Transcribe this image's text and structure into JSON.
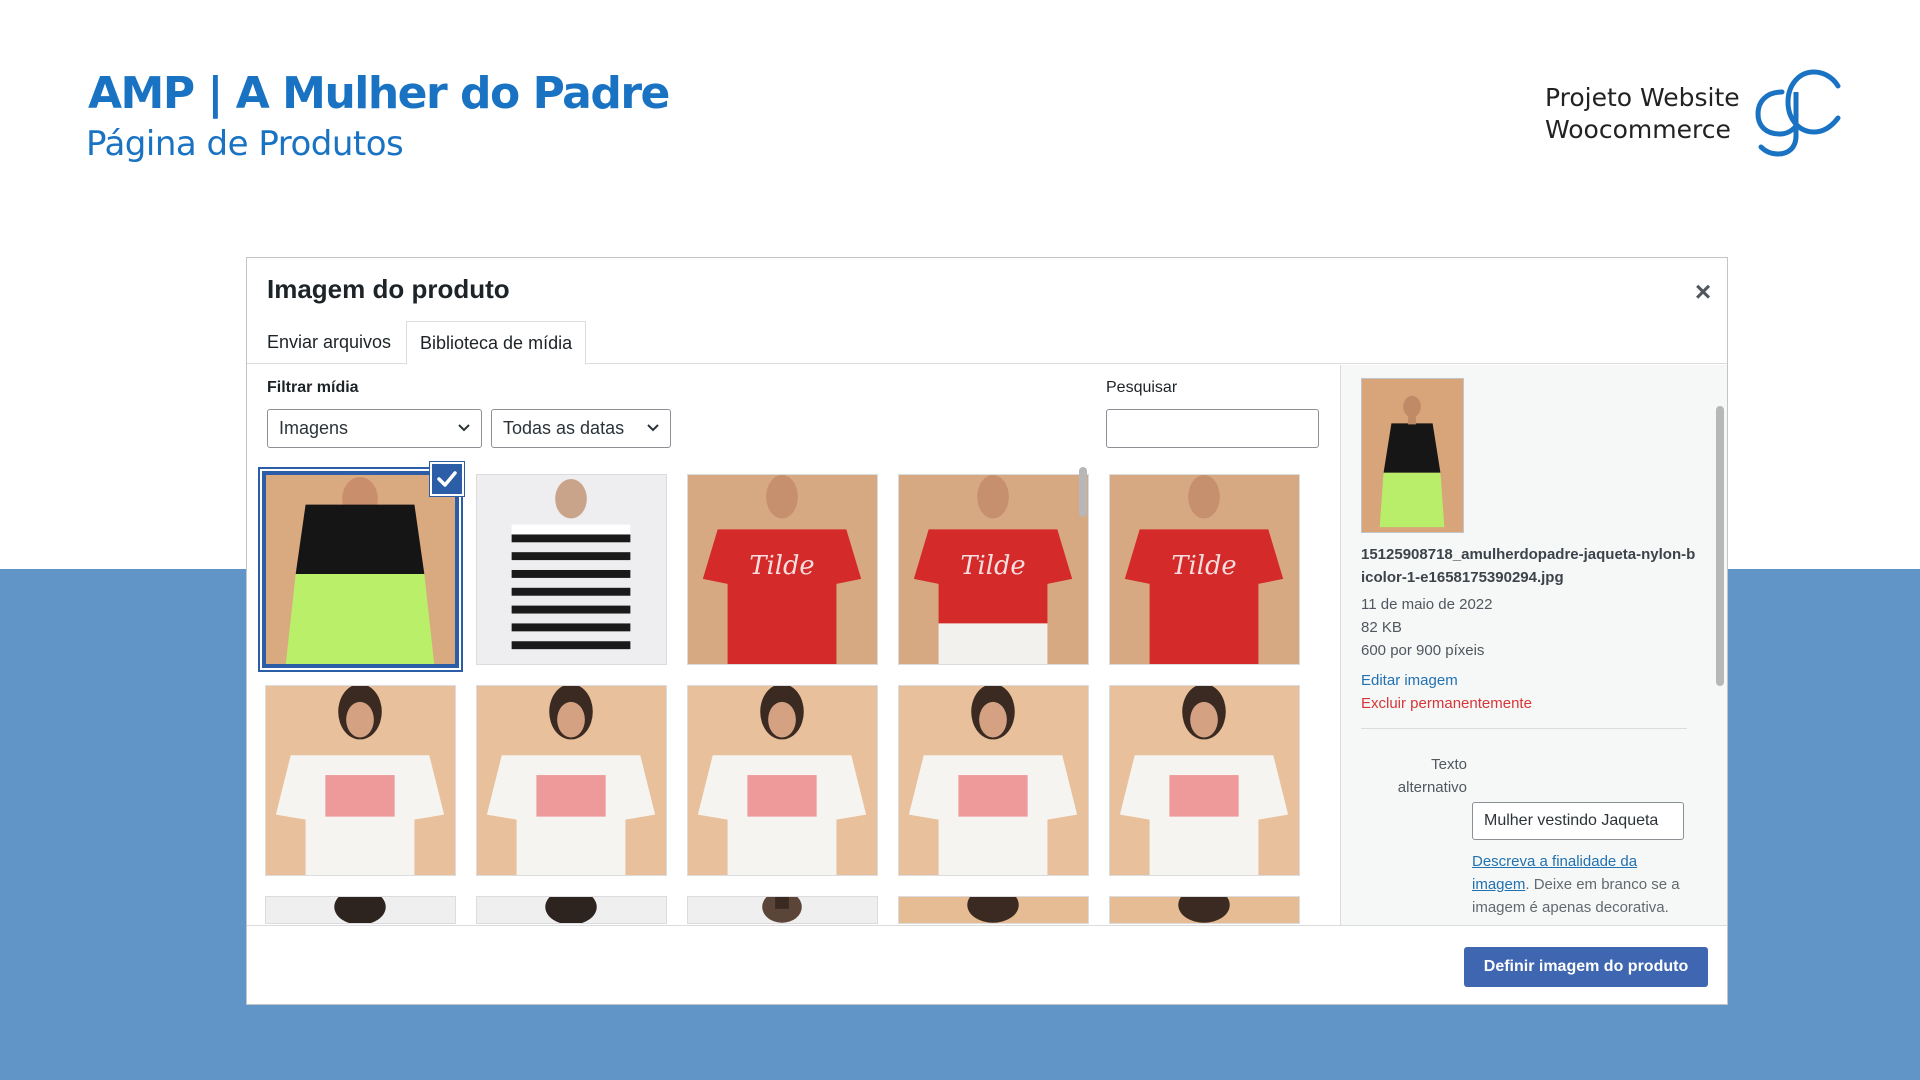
{
  "header": {
    "title": "AMP | A Mulher do Padre",
    "subtitle": "Página de Produtos",
    "project_line1": "Projeto Website",
    "project_line2": "Woocommerce",
    "logo_text": "gC"
  },
  "colors": {
    "brand_blue": "#1a73c2",
    "band_blue": "#6295c7",
    "wp_primary": "#3f66b0",
    "wp_link": "#2271b1",
    "wp_danger": "#d63638"
  },
  "modal": {
    "title": "Imagem do produto",
    "close_icon": "close-icon",
    "tabs": [
      "Enviar arquivos",
      "Biblioteca de mídia"
    ],
    "active_tab": "Biblioteca de mídia"
  },
  "filters": {
    "label": "Filtrar mídia",
    "type_selected": "Imagens",
    "date_selected": "Todas as datas",
    "search_label": "Pesquisar",
    "search_value": ""
  },
  "grid": {
    "images": [
      {
        "kind": "jacket",
        "selected": true
      },
      {
        "kind": "stripes"
      },
      {
        "kind": "redtee"
      },
      {
        "kind": "redtee2"
      },
      {
        "kind": "redtee"
      },
      {
        "kind": "whitetee"
      },
      {
        "kind": "whitetee"
      },
      {
        "kind": "whitetee"
      },
      {
        "kind": "whitetee"
      },
      {
        "kind": "whitetee"
      },
      {
        "kind": "manhead"
      },
      {
        "kind": "manhead"
      },
      {
        "kind": "manhead2"
      },
      {
        "kind": "womanhead"
      },
      {
        "kind": "womanhead"
      }
    ]
  },
  "details": {
    "filename": "15125908718_amulherdopadre-jaqueta-nylon-bicolor-1-e1658175390294.jpg",
    "date": "11 de maio de 2022",
    "size": "82 KB",
    "dimensions": "600 por 900 píxeis",
    "edit_link": "Editar imagem",
    "delete_link": "Excluir permanentemente",
    "alt_label": "Texto alternativo",
    "alt_value": "Mulher vestindo Jaqueta",
    "alt_help_link": "Descreva a finalidade da imagem",
    "alt_help_rest": ". Deixe em branco se a imagem é apenas decorativa."
  },
  "toolbar": {
    "primary_label": "Definir imagem do produto"
  }
}
